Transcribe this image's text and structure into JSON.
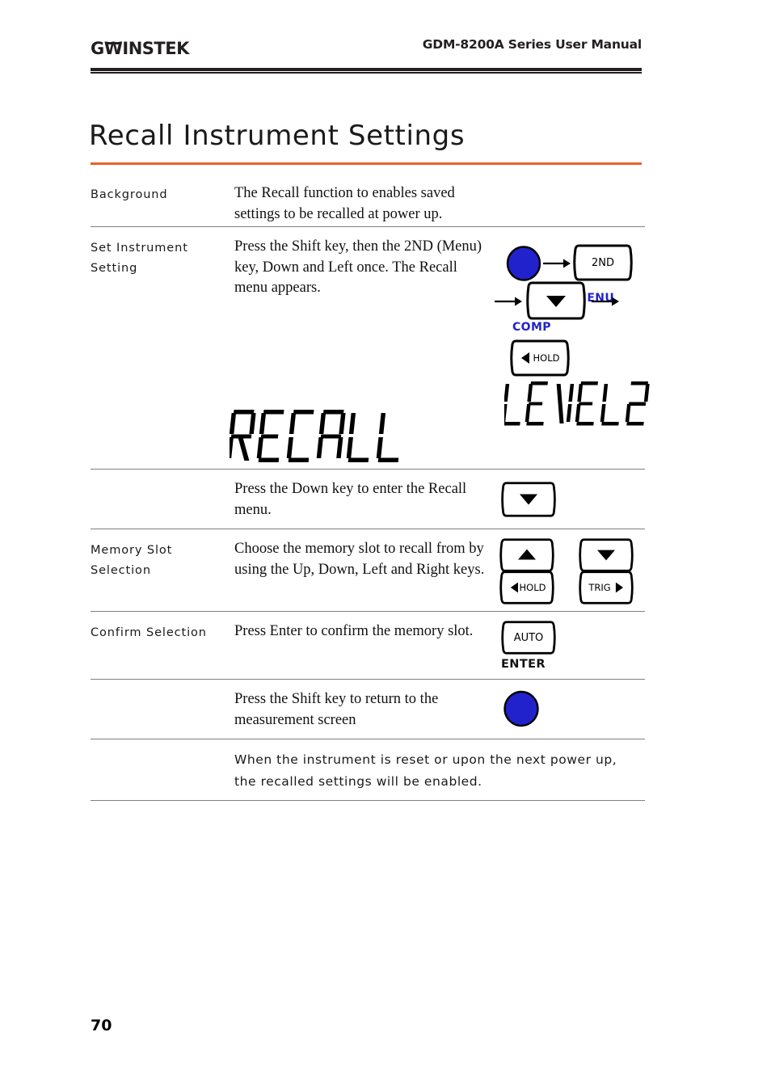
{
  "header": {
    "logo_g": "G",
    "logo_w": "W",
    "logo_rest": "INSTEK",
    "manual_title": "GDM-8200A Series User Manual"
  },
  "page_title": "Recall Instrument Settings",
  "page_number": "70",
  "colors": {
    "title_rule": "#e8622a",
    "shift_key_blue": "#2222cc",
    "label_blue": "#2222cc",
    "row_rule": "#808080"
  },
  "rows": [
    {
      "label": "Background",
      "body": "The Recall function to enables saved settings to be recalled at power up."
    },
    {
      "label": "Set Instrument Setting",
      "body": "Press the Shift key, then the 2ND (Menu) key, Down and Left once. The Recall menu appears.",
      "art": {
        "menu_label": "MENU",
        "comp_label": "COMP",
        "key_2nd": "2ND",
        "key_hold": "HOLD",
        "lcd_main": "RECALL",
        "lcd_secondary": "LEVEL2"
      }
    },
    {
      "label": "",
      "body": "Press the Down key to enter the Recall menu."
    },
    {
      "label": "Memory Slot Selection",
      "body": "Choose the memory slot to recall from by using the Up, Down, Left and Right keys.",
      "art": {
        "key_hold": "HOLD",
        "key_trig": "TRIG"
      }
    },
    {
      "label": "Confirm Selection",
      "body": "Press Enter to confirm the memory slot.",
      "art": {
        "key_auto": "AUTO",
        "enter_label": "ENTER"
      }
    },
    {
      "label": "",
      "body": "Press the Shift key to return to the measurement screen"
    },
    {
      "label": "",
      "body": "When the instrument is reset or upon the next power up, the recalled settings will be enabled."
    }
  ]
}
